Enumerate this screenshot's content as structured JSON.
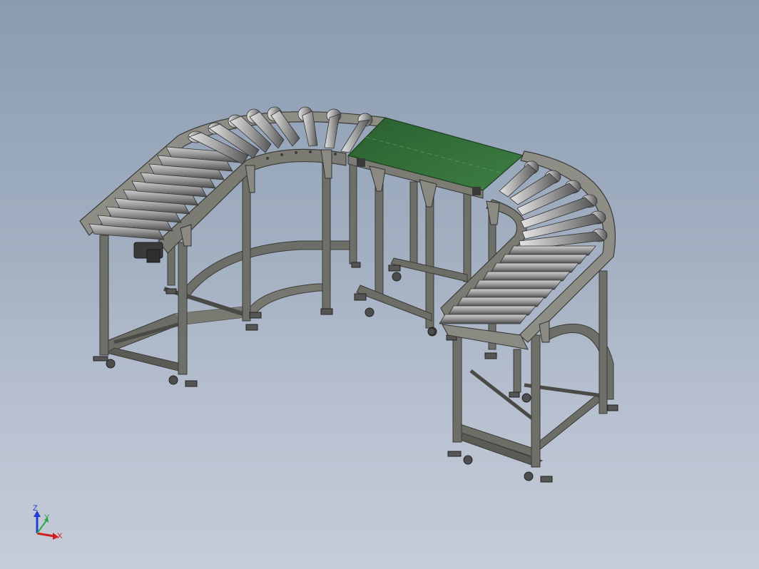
{
  "scene": {
    "subject": "conveyor-assembly",
    "colors": {
      "background_top": "#8a9bb0",
      "background_bottom": "#c6ccd8",
      "frame": "#6f6f69",
      "frame_dark": "#4b4b47",
      "frame_light": "#9a9a93",
      "roller_light": "#d8d8d8",
      "roller_mid": "#8c8c8c",
      "roller_dark": "#4e4e4e",
      "belt": "#2f6a35",
      "belt_light": "#4b8a4f",
      "motor": "#3b3b3b",
      "caster": "#505050"
    }
  },
  "triad": {
    "z_label": "Z",
    "y_label": "Y",
    "x_label": "X",
    "z_color": "#1e3fd0",
    "y_color": "#2aa84a",
    "x_color": "#d01e1e"
  }
}
